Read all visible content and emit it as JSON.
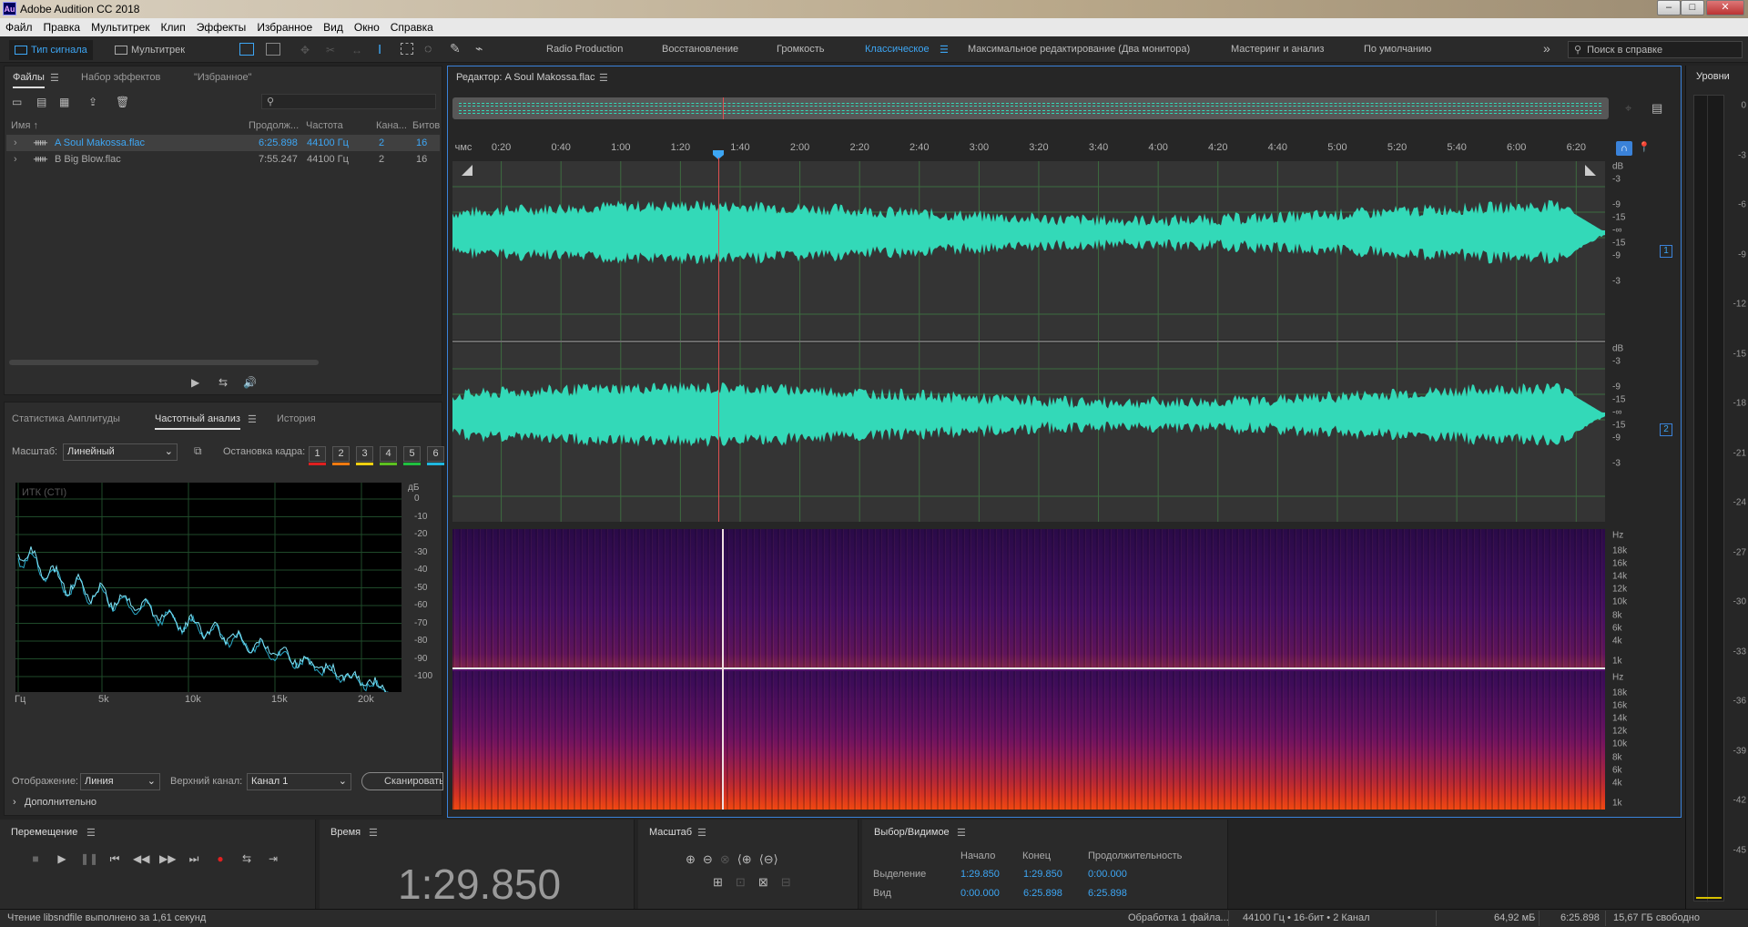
{
  "window": {
    "title": "Adobe Audition CC 2018",
    "logo_text": "Au",
    "minimize": "–",
    "maximize": "□",
    "close": "✕"
  },
  "menu": [
    "Файл",
    "Правка",
    "Мультитрек",
    "Клип",
    "Эффекты",
    "Избранное",
    "Вид",
    "Окно",
    "Справка"
  ],
  "toolbar": {
    "waveform_label": "Тип сигнала",
    "multitrack_label": "Мультитрек",
    "workspaces": [
      "Radio Production",
      "Восстановление",
      "Громкость",
      "Классическое",
      "Максимальное редактирование (Два монитора)",
      "Мастеринг и анализ",
      "По умолчанию"
    ],
    "active_workspace": "Классическое",
    "more": "»",
    "help_search_placeholder": "Поиск в справке"
  },
  "files_panel": {
    "tabs": [
      "Файлы",
      "Набор эффектов",
      "\"Избранное\""
    ],
    "search_placeholder": "",
    "columns": [
      "Имя ↑",
      "Продолж...",
      "Частота",
      "Кана...",
      "Битов"
    ],
    "rows": [
      {
        "name": "A Soul Makossa.flac",
        "duration": "6:25.898",
        "rate": "44100 Гц",
        "channels": "2",
        "bits": "16",
        "selected": true
      },
      {
        "name": "B Big Blow.flac",
        "duration": "7:55.247",
        "rate": "44100 Гц",
        "channels": "2",
        "bits": "16",
        "selected": false
      }
    ]
  },
  "analysis_panel": {
    "tabs": [
      "Статистика Амплитуды",
      "Частотный анализ",
      "История"
    ],
    "scale_label": "Масштаб:",
    "scale_value": "Линейный",
    "freeze_label": "Остановка кадра:",
    "freeze_slots": [
      "1",
      "2",
      "3",
      "4",
      "5",
      "6"
    ],
    "freeze_colors": [
      "#e02020",
      "#f07a10",
      "#f0d010",
      "#5cc020",
      "#20c040",
      "#20b8e0"
    ],
    "graph_label": "ИТК (CTI)",
    "db_unit": "дБ",
    "db_ticks": [
      "0",
      "-10",
      "-20",
      "-30",
      "-40",
      "-50",
      "-60",
      "-70",
      "-80",
      "-90",
      "-100"
    ],
    "x_ticks": [
      "Гц",
      "5k",
      "10k",
      "15k",
      "20k"
    ],
    "display_label": "Отображение:",
    "display_value": "Линия",
    "channel_label": "Верхний канал:",
    "channel_value": "Канал 1",
    "scan_button": "Сканировать",
    "advanced": "Дополнительно"
  },
  "editor": {
    "title": "Редактор: A Soul Makossa.flac",
    "ruler_unit": "чмс",
    "ruler": [
      "0:20",
      "0:40",
      "1:00",
      "1:20",
      "1:40",
      "2:00",
      "2:20",
      "2:40",
      "3:00",
      "3:20",
      "3:40",
      "4:00",
      "4:20",
      "4:40",
      "5:00",
      "5:20",
      "5:40",
      "6:00",
      "6:20"
    ],
    "db_ticks_top": [
      "dB",
      "-3",
      "-9",
      "-15",
      "-∞",
      "-15",
      "-9",
      "-3"
    ],
    "db_ticks_bottom": [
      "dB",
      "-3",
      "-9",
      "-15",
      "-∞",
      "-15",
      "-9",
      "-3"
    ],
    "hz_ticks": [
      "Hz",
      "18k",
      "16k",
      "14k",
      "12k",
      "10k",
      "8k",
      "6k",
      "4k",
      "1k"
    ],
    "channel_badges": [
      "1",
      "2"
    ],
    "waveform_color": "#33d9b8",
    "playhead_time": "1:29.850"
  },
  "levels": {
    "title": "Уровни",
    "ticks": [
      "0",
      "-3",
      "-6",
      "-9",
      "-12",
      "-15",
      "-18",
      "-21",
      "-24",
      "-27",
      "-30",
      "-33",
      "-36",
      "-39",
      "-42",
      "-45"
    ]
  },
  "transport": {
    "title": "Перемещение"
  },
  "time_panel": {
    "title": "Время",
    "value": "1:29.850"
  },
  "zoom_panel": {
    "title": "Масштаб"
  },
  "selection_panel": {
    "title": "Выбор/Видимое",
    "headers": [
      "Начало",
      "Конец",
      "Продолжительность"
    ],
    "rows": [
      {
        "label": "Выделение",
        "start": "1:29.850",
        "end": "1:29.850",
        "duration": "0:00.000"
      },
      {
        "label": "Вид",
        "start": "0:00.000",
        "end": "6:25.898",
        "duration": "6:25.898"
      }
    ]
  },
  "status": {
    "left": "Чтение libsndfile выполнено за 1,61 секунд",
    "processing": "Обработка 1 файла...",
    "format": "44100 Гц • 16-бит • 2 Канал",
    "size": "64,92 мБ",
    "duration": "6:25.898",
    "free": "15,67 ГБ свободно"
  }
}
